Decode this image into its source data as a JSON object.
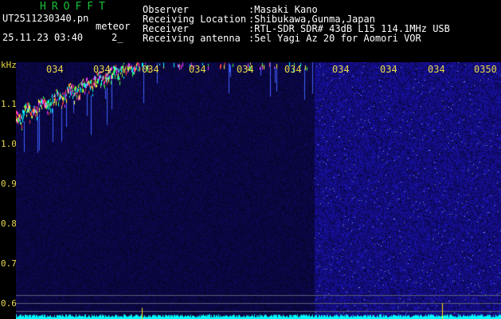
{
  "header": {
    "logo": "HROFFT",
    "filename": "UT2511230340.pn",
    "type": "meteor",
    "date_time": "25.11.23 03:40",
    "count": "2_",
    "info": [
      {
        "key": "Observer",
        "value": ":Masaki Kano"
      },
      {
        "key": "Receiving Location",
        "value": ":Shibukawa,Gunma,Japan"
      },
      {
        "key": "Receiver",
        "value": ":RTL-SDR SDR# 43dB L15 114.1MHz USB"
      },
      {
        "key": "Receiving antenna",
        "value": ":5el Yagi Az 20 for Aomori VOR"
      }
    ]
  },
  "axis": {
    "unit": "kHz",
    "y_ticks": [
      "1.1",
      "1.0",
      "0.9",
      "0.8",
      "0.7",
      "0.6"
    ],
    "x_ticks": [
      "034",
      "034",
      "034",
      "034",
      "034",
      "034",
      "034",
      "034",
      "034",
      "0350"
    ]
  },
  "colors": {
    "label": "#e8d84a",
    "grid": "#5d5d7a",
    "background_noise": "#0a0a5a",
    "signal": "#00ffff"
  }
}
